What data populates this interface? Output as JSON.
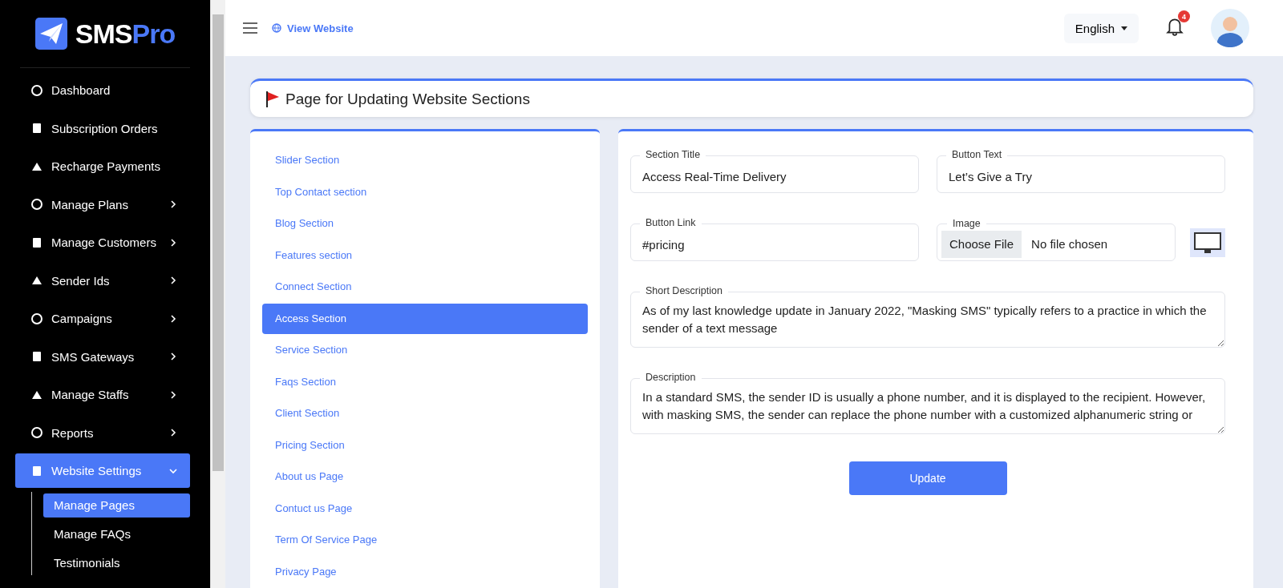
{
  "brand": {
    "name_first": "SMS",
    "name_second": "Pro"
  },
  "sidebar": {
    "items": [
      {
        "label": "Dashboard",
        "has_submenu": false,
        "selected": false
      },
      {
        "label": "Subscription Orders",
        "has_submenu": false,
        "selected": false
      },
      {
        "label": "Recharge Payments",
        "has_submenu": false,
        "selected": false
      },
      {
        "label": "Manage Plans",
        "has_submenu": true,
        "expanded": false,
        "selected": false
      },
      {
        "label": "Manage Customers",
        "has_submenu": true,
        "expanded": false,
        "selected": false
      },
      {
        "label": "Sender Ids",
        "has_submenu": true,
        "expanded": false,
        "selected": false
      },
      {
        "label": "Campaigns",
        "has_submenu": true,
        "expanded": false,
        "selected": false
      },
      {
        "label": "SMS Gateways",
        "has_submenu": true,
        "expanded": false,
        "selected": false
      },
      {
        "label": "Manage Staffs",
        "has_submenu": true,
        "expanded": false,
        "selected": false
      },
      {
        "label": "Reports",
        "has_submenu": true,
        "expanded": false,
        "selected": false
      },
      {
        "label": "Website Settings",
        "has_submenu": true,
        "expanded": true,
        "selected": true,
        "children": [
          {
            "label": "Manage Pages",
            "selected": true
          },
          {
            "label": "Manage FAQs",
            "selected": false
          },
          {
            "label": "Testimonials",
            "selected": false
          }
        ]
      }
    ]
  },
  "topbar": {
    "view_website": "View Website",
    "language": "English",
    "notifications": "4"
  },
  "page_title": "Page for Updating Website Sections",
  "sections": [
    {
      "label": "Slider Section",
      "selected": false
    },
    {
      "label": "Top Contact section",
      "selected": false
    },
    {
      "label": "Blog Section",
      "selected": false
    },
    {
      "label": "Features section",
      "selected": false
    },
    {
      "label": "Connect Section",
      "selected": false
    },
    {
      "label": "Access Section",
      "selected": true
    },
    {
      "label": "Service Section",
      "selected": false
    },
    {
      "label": "Faqs Section",
      "selected": false
    },
    {
      "label": "Client Section",
      "selected": false
    },
    {
      "label": "Pricing Section",
      "selected": false
    },
    {
      "label": "About us Page",
      "selected": false
    },
    {
      "label": "Contuct us Page",
      "selected": false
    },
    {
      "label": "Term Of Service Page",
      "selected": false
    },
    {
      "label": "Privacy Page",
      "selected": false
    }
  ],
  "form": {
    "section_title": {
      "label": "Section Title",
      "value": "Access Real-Time Delivery"
    },
    "button_text": {
      "label": "Button Text",
      "value": "Let’s Give a Try"
    },
    "button_link": {
      "label": "Button Link",
      "value": "#pricing"
    },
    "image": {
      "label": "Image",
      "button": "Choose File",
      "status": "No file chosen"
    },
    "short_description": {
      "label": "Short Description",
      "value": "As of my last knowledge update in January 2022, \"Masking SMS\" typically refers to a practice in which the sender of a text message"
    },
    "description": {
      "label": "Description",
      "value": "In a standard SMS, the sender ID is usually a phone number, and it is displayed to the recipient. However, with masking SMS, the sender can replace the phone number with a customized alphanumeric string or"
    },
    "submit": "Update"
  }
}
